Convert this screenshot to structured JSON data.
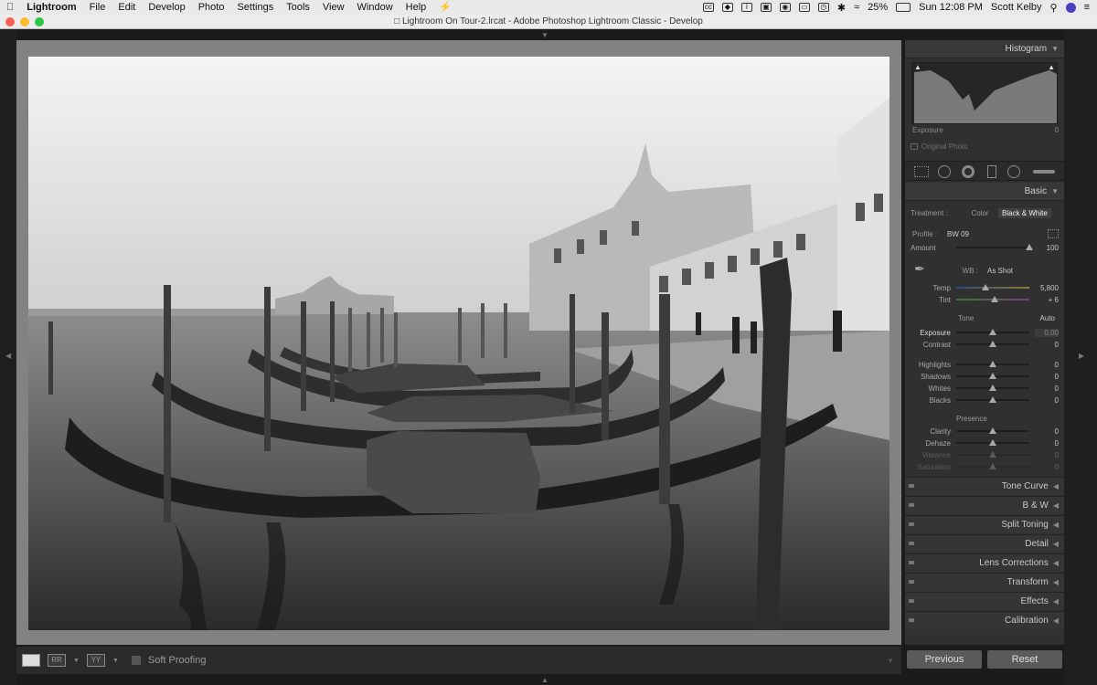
{
  "menubar": {
    "app_name": "Lightroom",
    "menus": [
      "File",
      "Edit",
      "Develop",
      "Photo",
      "Settings",
      "Tools",
      "View",
      "Window",
      "Help"
    ],
    "battery": "25%",
    "clock": "Sun 12:08 PM",
    "user": "Scott Kelby"
  },
  "window": {
    "title": "Lightroom On Tour-2.lrcat - Adobe Photoshop Lightroom Classic - Develop"
  },
  "toolbar": {
    "soft_proofing": "Soft Proofing",
    "compare_label": "YY"
  },
  "panel": {
    "histogram": {
      "title": "Histogram",
      "exposure_label": "Exposure",
      "exposure_value": "0",
      "original_photo": "Original Photo"
    },
    "basic": {
      "title": "Basic",
      "treatment_label": "Treatment :",
      "treatment_color": "Color",
      "treatment_bw": "Black & White",
      "profile_label": "Profile :",
      "profile_value": "BW 09",
      "amount": {
        "label": "Amount",
        "value": "100",
        "level": 1.0
      },
      "wb_label": "WB :",
      "wb_value": "As Shot",
      "temp": {
        "label": "Temp",
        "value": "5,800",
        "level": 0.4
      },
      "tint": {
        "label": "Tint",
        "value": "+ 6",
        "level": 0.52
      },
      "tone_label": "Tone",
      "auto_label": "Auto",
      "exposure": {
        "label": "Exposure",
        "value": "0.00",
        "level": 0.5
      },
      "contrast": {
        "label": "Contrast",
        "value": "0",
        "level": 0.5
      },
      "highlights": {
        "label": "Highlights",
        "value": "0",
        "level": 0.5
      },
      "shadows": {
        "label": "Shadows",
        "value": "0",
        "level": 0.5
      },
      "whites": {
        "label": "Whites",
        "value": "0",
        "level": 0.5
      },
      "blacks": {
        "label": "Blacks",
        "value": "0",
        "level": 0.5
      },
      "presence_label": "Presence",
      "clarity": {
        "label": "Clarity",
        "value": "0",
        "level": 0.5
      },
      "dehaze": {
        "label": "Dehaze",
        "value": "0",
        "level": 0.5
      },
      "vibrance": {
        "label": "Vibrance",
        "value": "0",
        "level": 0.5
      },
      "saturation": {
        "label": "Saturation",
        "value": "0",
        "level": 0.5
      }
    },
    "sections": [
      "Tone Curve",
      "B & W",
      "Split Toning",
      "Detail",
      "Lens Corrections",
      "Transform",
      "Effects",
      "Calibration"
    ],
    "previous_button": "Previous",
    "reset_button": "Reset"
  }
}
